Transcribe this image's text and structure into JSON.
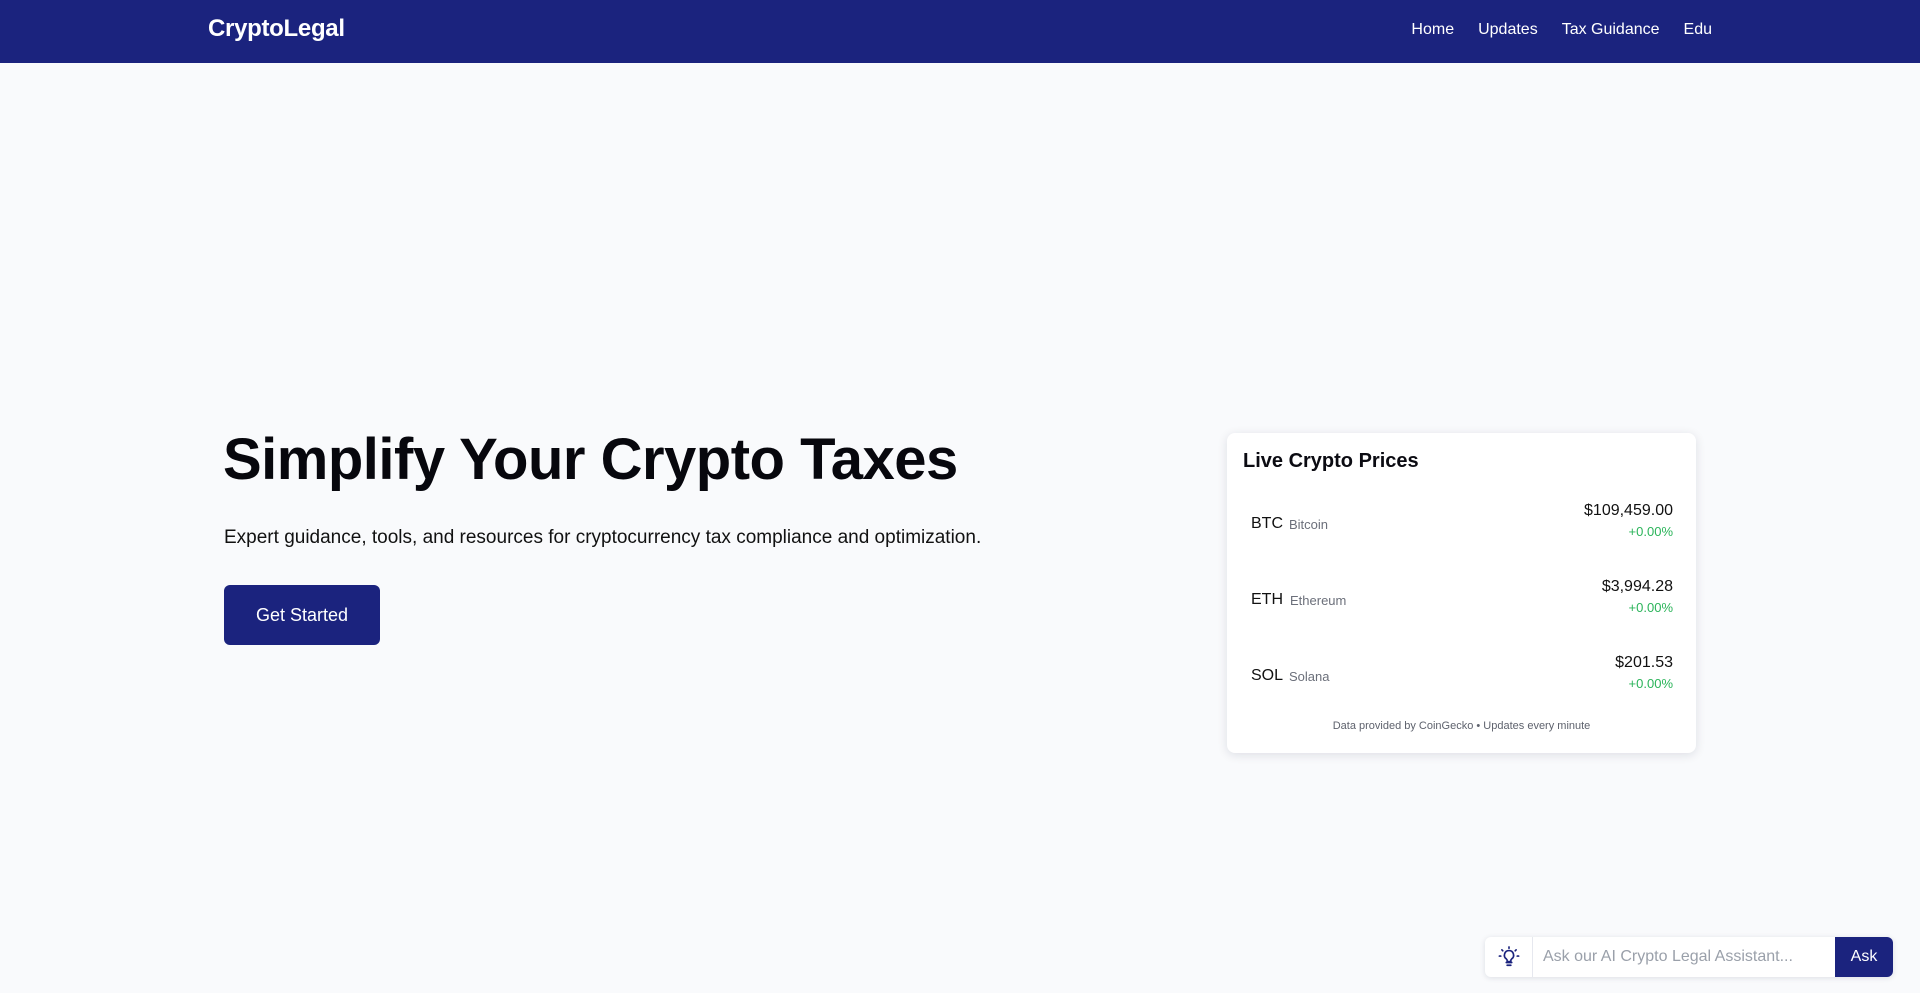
{
  "header": {
    "brand": "CryptoLegal",
    "nav": [
      "Home",
      "Updates",
      "Tax Guidance",
      "Edu"
    ]
  },
  "hero": {
    "title": "Simplify Your Crypto Taxes",
    "subtitle": "Expert guidance, tools, and resources for cryptocurrency tax compliance and optimization.",
    "cta_label": "Get Started"
  },
  "prices": {
    "title": "Live Crypto Prices",
    "coins": [
      {
        "symbol": "BTC",
        "name": "Bitcoin",
        "price": "$109,459.00",
        "change": "+0.00%"
      },
      {
        "symbol": "ETH",
        "name": "Ethereum",
        "price": "$3,994.28",
        "change": "+0.00%"
      },
      {
        "symbol": "SOL",
        "name": "Solana",
        "price": "$201.53",
        "change": "+0.00%"
      }
    ],
    "footer": "Data provided by CoinGecko • Updates every minute"
  },
  "assistant": {
    "icon": "lightbulb-icon",
    "placeholder": "Ask our AI Crypto Legal Assistant...",
    "value": "",
    "button_label": "Ask"
  },
  "colors": {
    "primary": "#1b237e",
    "background": "#f9fafc",
    "positive": "#2bb45a"
  }
}
